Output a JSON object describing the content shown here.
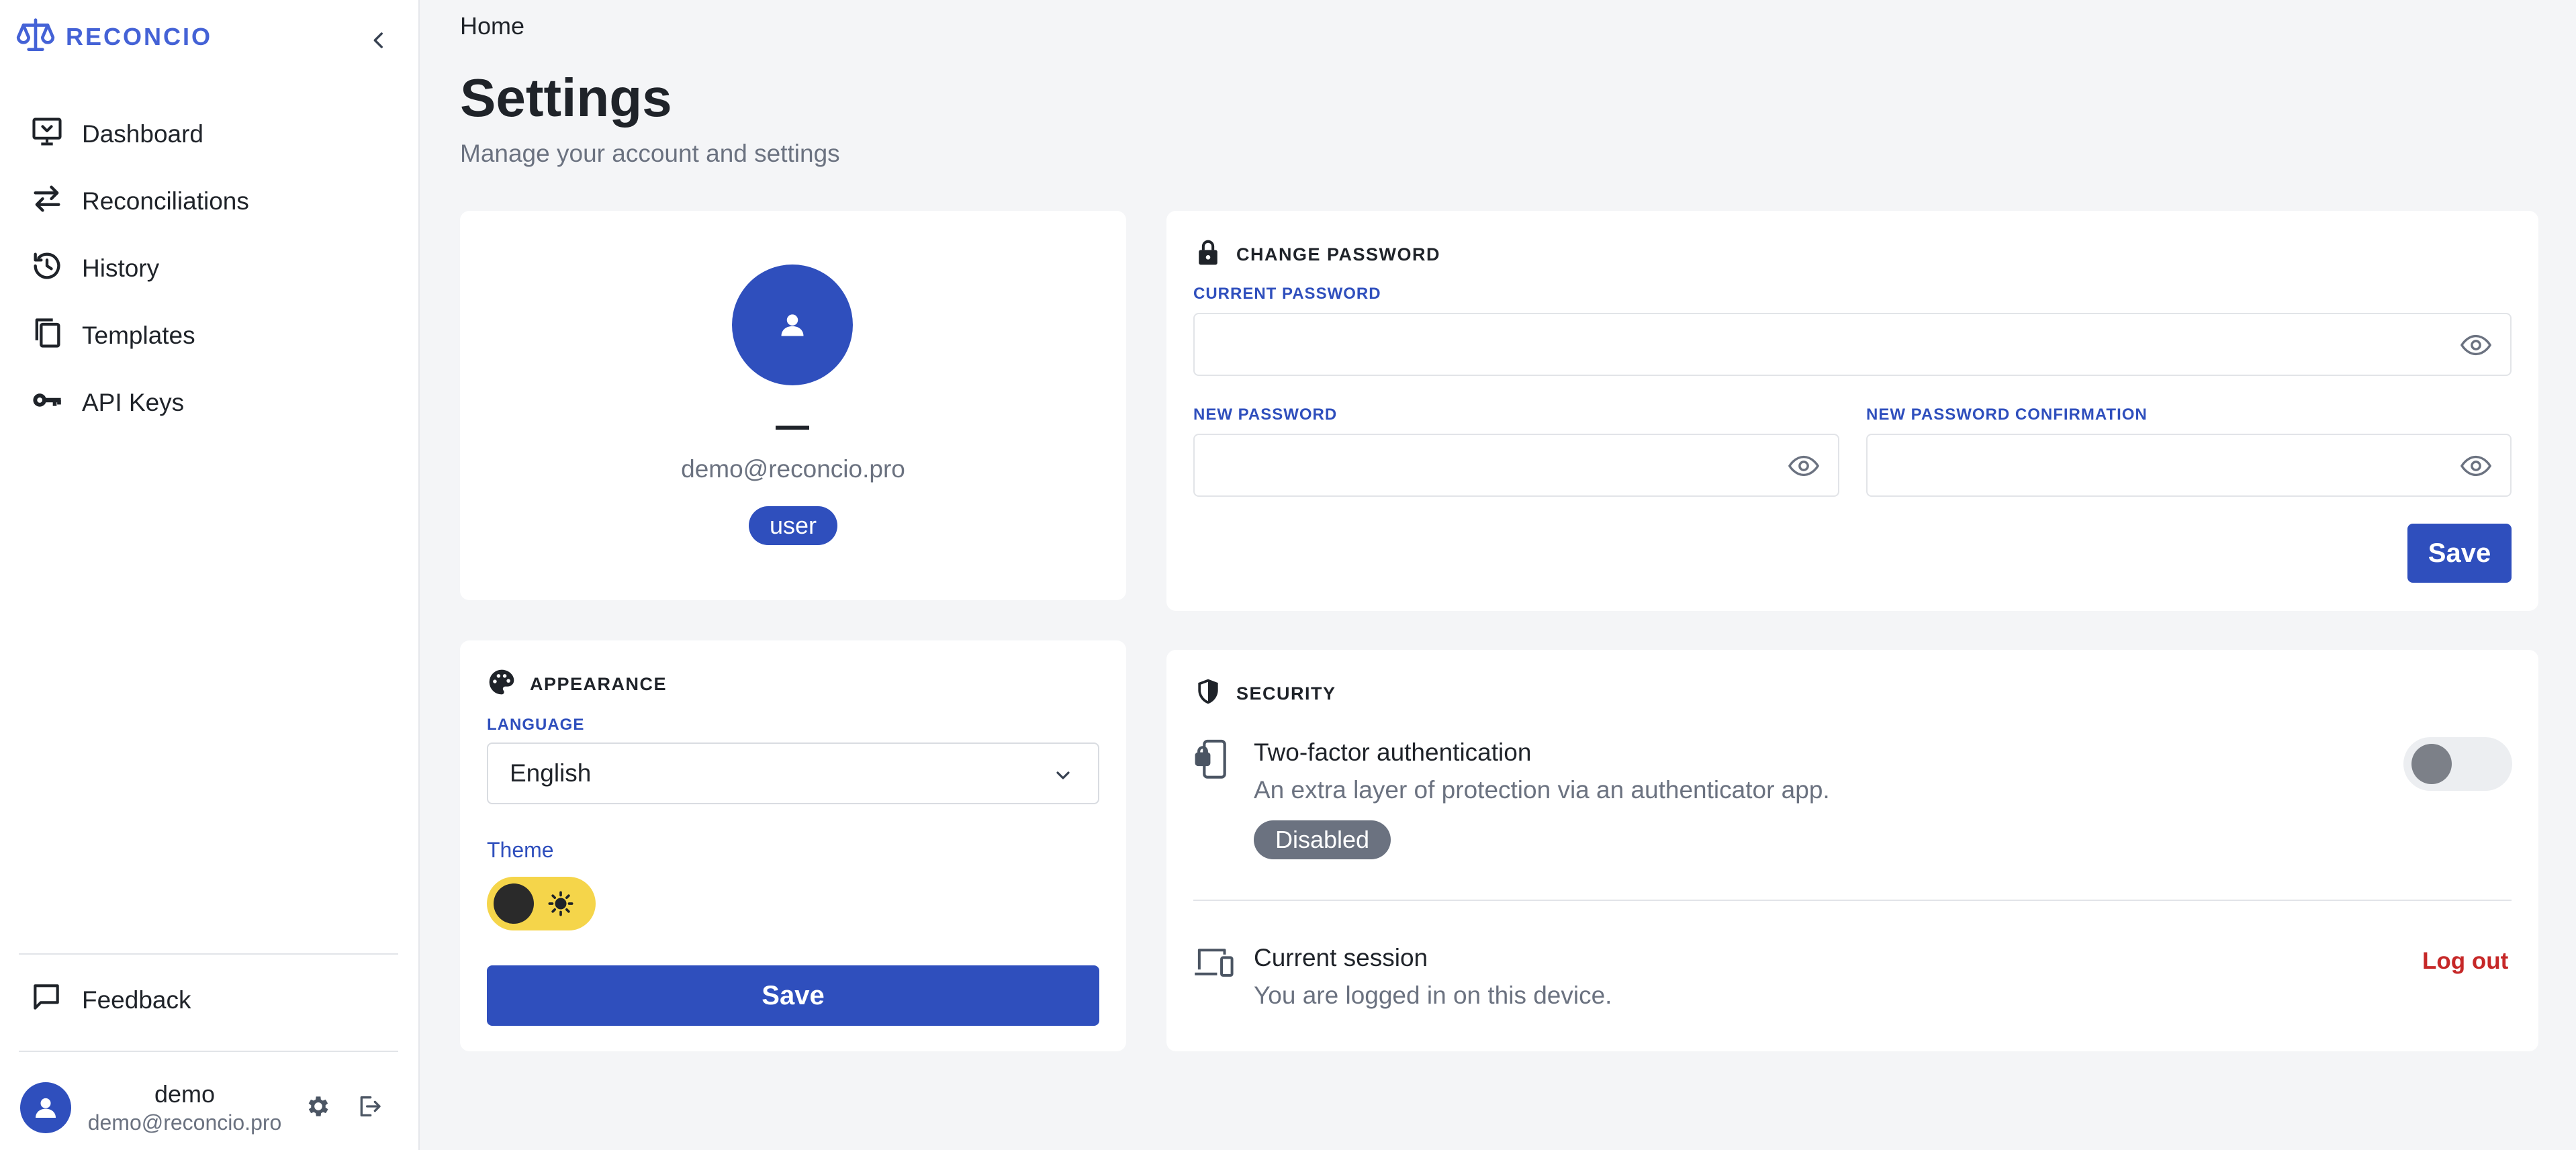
{
  "app": {
    "brand": "RECONCIO",
    "accent": "#2f4fbd",
    "brand_color": "#4462d6"
  },
  "sidebar": {
    "items": [
      {
        "label": "Dashboard",
        "icon": "monitor-icon"
      },
      {
        "label": "Reconciliations",
        "icon": "arrows-swap-icon"
      },
      {
        "label": "History",
        "icon": "history-icon"
      },
      {
        "label": "Templates",
        "icon": "copy-icon"
      },
      {
        "label": "API Keys",
        "icon": "key-icon"
      }
    ],
    "feedback": "Feedback",
    "user": {
      "name": "demo",
      "email": "demo@reconcio.pro"
    }
  },
  "header": {
    "breadcrumb": "Home",
    "title": "Settings",
    "subtitle": "Manage your account and settings"
  },
  "profile": {
    "name": "—",
    "email": "demo@reconcio.pro",
    "role": "user"
  },
  "appearance": {
    "heading": "APPEARANCE",
    "language_label": "LANGUAGE",
    "language_value": "English",
    "theme_label": "Theme",
    "theme_mode": "light",
    "save": "Save"
  },
  "password": {
    "heading": "CHANGE PASSWORD",
    "current_label": "CURRENT PASSWORD",
    "new_label": "NEW PASSWORD",
    "confirm_label": "NEW PASSWORD CONFIRMATION",
    "save": "Save"
  },
  "security": {
    "heading": "SECURITY",
    "twofa_title": "Two-factor authentication",
    "twofa_desc": "An extra layer of protection via an authenticator app.",
    "twofa_status": "Disabled",
    "twofa_enabled": false,
    "session_title": "Current session",
    "session_desc": "You are logged in on this device.",
    "logout": "Log out",
    "danger_color": "#c62828"
  }
}
